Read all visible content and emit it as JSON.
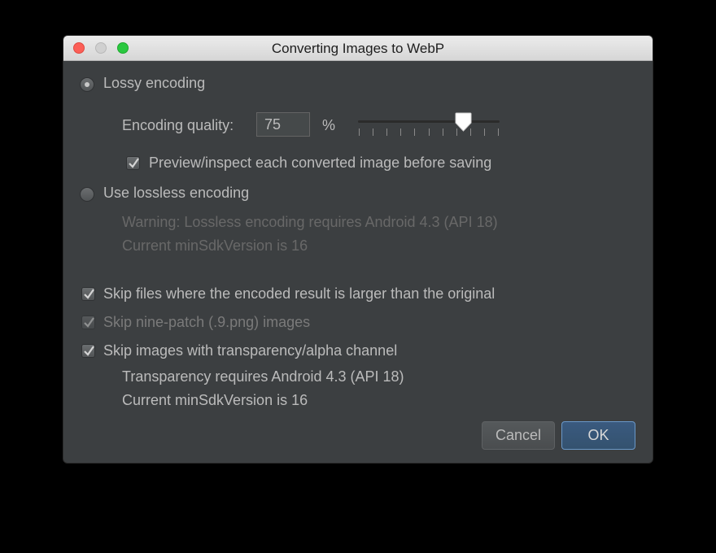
{
  "window": {
    "title": "Converting Images to WebP"
  },
  "lossy": {
    "label": "Lossy encoding",
    "selected": true,
    "quality_label": "Encoding quality:",
    "quality_value": "75",
    "quality_unit": "%",
    "slider_value_percent": 75,
    "slider_tick_count": 11,
    "preview_label": "Preview/inspect each converted image before saving",
    "preview_checked": true
  },
  "lossless": {
    "label": "Use lossless encoding",
    "selected": false,
    "warning_line1": "Warning: Lossless encoding requires Android 4.3 (API 18)",
    "warning_line2": "Current minSdkVersion is 16"
  },
  "options": {
    "skip_larger_label": "Skip files where the encoded result is larger than the original",
    "skip_larger_checked": true,
    "skip_ninepatch_label": "Skip nine-patch (.9.png) images",
    "skip_ninepatch_checked": true,
    "skip_transparency_label": "Skip images with transparency/alpha channel",
    "skip_transparency_checked": true,
    "transparency_note1": "Transparency requires Android 4.3 (API 18)",
    "transparency_note2": "Current minSdkVersion is 16"
  },
  "buttons": {
    "cancel": "Cancel",
    "ok": "OK"
  },
  "colors": {
    "dialog_bg": "#3c3f41",
    "text": "#bbbbbb",
    "disabled_text": "#686868",
    "ok_border": "#6a98c8"
  },
  "icons": {
    "close": "close-traffic-light-icon",
    "minimize": "minimize-traffic-light-icon",
    "maximize": "maximize-traffic-light-icon",
    "checkmark": "checkmark-icon",
    "slider_thumb": "slider-thumb-icon"
  }
}
